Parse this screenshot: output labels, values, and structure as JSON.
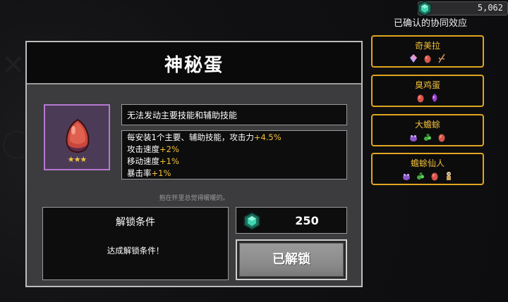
{
  "currency": {
    "value": "5,062",
    "icon": "gem-icon"
  },
  "synergy": {
    "title": "已确认的协同效应",
    "items": [
      {
        "name": "奇美拉",
        "icons": [
          "crystal-icon",
          "egg-icon",
          "branch-icon"
        ]
      },
      {
        "name": "臭鸡蛋",
        "icons": [
          "egg-icon",
          "purple-egg-icon"
        ]
      },
      {
        "name": "大蟾蜍",
        "icons": [
          "purple-frog-icon",
          "green-slime-icon",
          "egg-icon"
        ]
      },
      {
        "name": "蟾蜍仙人",
        "icons": [
          "purple-frog-icon",
          "green-slime-icon",
          "egg-icon",
          "sage-icon"
        ]
      }
    ]
  },
  "panel": {
    "title": "神秘蛋",
    "item": {
      "icon": "mystery-egg-icon",
      "stars": "★★★"
    },
    "description": "无法发动主要技能和辅助技能",
    "stats": [
      {
        "text": "每安装1个主要、辅助技能，攻击力",
        "bonus": "+4.5%"
      },
      {
        "text": "攻击速度",
        "bonus": "+2%"
      },
      {
        "text": "移动速度",
        "bonus": "+1%"
      },
      {
        "text": "暴击率",
        "bonus": "+1%"
      }
    ],
    "flavor": "抱在怀里总觉得暖暖的。",
    "unlock": {
      "title": "解锁条件",
      "description": "达成解锁条件！"
    },
    "cost": {
      "value": "250"
    },
    "button_label": "已解锁"
  },
  "colors": {
    "accent": "#f3c03a",
    "border_gold": "#e0a520",
    "item_border": "#b678d0"
  }
}
